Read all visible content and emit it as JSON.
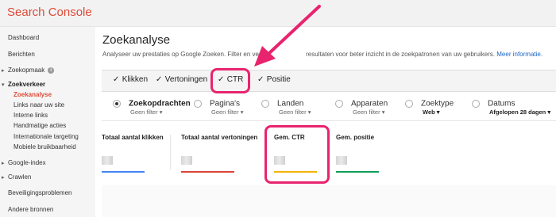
{
  "app": {
    "title": "Search Console"
  },
  "sidebar": {
    "items": [
      {
        "label": "Dashboard"
      },
      {
        "label": "Berichten"
      },
      {
        "label": "Zoekopmaak",
        "info": "i"
      },
      {
        "label": "Zoekverkeer"
      },
      {
        "label": "Google-index"
      },
      {
        "label": "Crawlen"
      },
      {
        "label": "Beveiligingsproblemen"
      },
      {
        "label": "Andere bronnen"
      }
    ],
    "sub_items": [
      {
        "label": "Zoekanalyse"
      },
      {
        "label": "Links naar uw site"
      },
      {
        "label": "Interne links"
      },
      {
        "label": "Handmatige acties"
      },
      {
        "label": "Internationale targeting"
      },
      {
        "label": "Mobiele bruikbaarheid"
      }
    ]
  },
  "main": {
    "title": "Zoekanalyse",
    "description_left": "Analyseer uw prestaties op Google Zoeken. Filter en verg",
    "description_right": "resultaten voor beter inzicht in de zoekpatronen van uw gebruikers.",
    "more_info": "Meer informatie."
  },
  "metrics": [
    {
      "label": "Klikken",
      "checked": "✓"
    },
    {
      "label": "Vertoningen",
      "checked": "✓"
    },
    {
      "label": "CTR",
      "checked": "✓"
    },
    {
      "label": "Positie",
      "checked": "✓"
    }
  ],
  "dimensions": [
    {
      "label": "Zoekopdrachten",
      "filter": "Geen filter"
    },
    {
      "label": "Pagina's",
      "filter": "Geen filter"
    },
    {
      "label": "Landen",
      "filter": "Geen filter"
    },
    {
      "label": "Apparaten",
      "filter": "Geen filter"
    },
    {
      "label": "Zoektype",
      "filter": "Web"
    },
    {
      "label": "Datums",
      "filter": "Afgelopen 28 dagen"
    }
  ],
  "cards": [
    {
      "title": "Totaal aantal klikken",
      "color": "#4285f4"
    },
    {
      "title": "Totaal aantal vertoningen",
      "color": "#db4437"
    },
    {
      "title": "Gem. CTR",
      "color": "#f4b400"
    },
    {
      "title": "Gem. positie",
      "color": "#0f9d58"
    }
  ],
  "colors": {
    "brand": "#dd4b39",
    "highlight": "#e8246e",
    "link": "#1a66c4"
  }
}
